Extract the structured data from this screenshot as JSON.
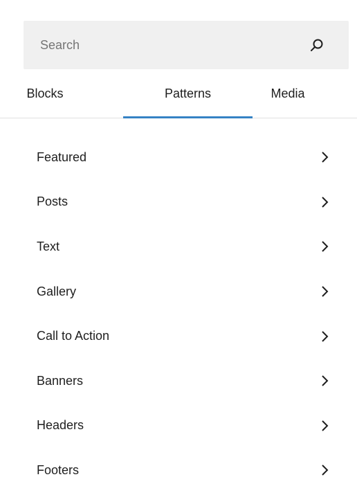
{
  "search": {
    "placeholder": "Search",
    "value": ""
  },
  "tabs": [
    {
      "label": "Blocks",
      "active": false
    },
    {
      "label": "Patterns",
      "active": true
    },
    {
      "label": "Media",
      "active": false
    }
  ],
  "categories": [
    {
      "label": "Featured"
    },
    {
      "label": "Posts"
    },
    {
      "label": "Text"
    },
    {
      "label": "Gallery"
    },
    {
      "label": "Call to Action"
    },
    {
      "label": "Banners"
    },
    {
      "label": "Headers"
    },
    {
      "label": "Footers"
    }
  ],
  "colors": {
    "accent": "#3582c4",
    "search_background": "#f0f0f0",
    "divider": "#e0e0e0",
    "text": "#1e1e1e"
  },
  "icons": {
    "search": "search-icon",
    "chevron": "chevron-right-icon"
  }
}
